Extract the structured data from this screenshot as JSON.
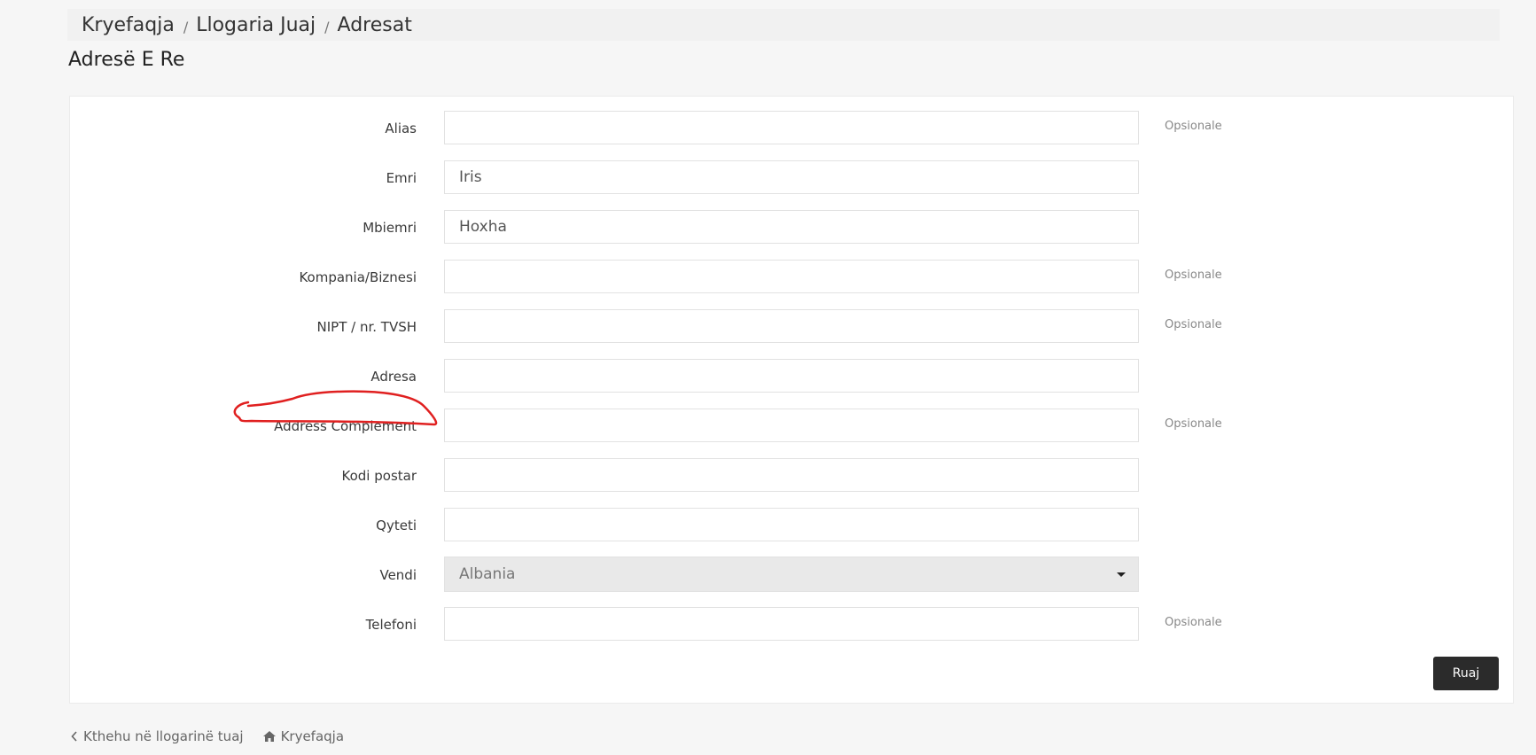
{
  "breadcrumb": {
    "items": [
      "Kryefaqja",
      "Llogaria Juaj",
      "Adresat"
    ],
    "separator": "/"
  },
  "page_title": "Adresë E Re",
  "form": {
    "optional_label": "Opsionale",
    "fields": [
      {
        "label": "Alias",
        "value": "",
        "optional": true
      },
      {
        "label": "Emri",
        "value": "Iris",
        "optional": false
      },
      {
        "label": "Mbiemri",
        "value": "Hoxha",
        "optional": false
      },
      {
        "label": "Kompania/Biznesi",
        "value": "",
        "optional": true
      },
      {
        "label": "NIPT / nr. TVSH",
        "value": "",
        "optional": true
      },
      {
        "label": "Adresa",
        "value": "",
        "optional": false
      },
      {
        "label": "Address Complement",
        "value": "",
        "optional": true
      },
      {
        "label": "Kodi postar",
        "value": "",
        "optional": false
      },
      {
        "label": "Qyteti",
        "value": "",
        "optional": false
      },
      {
        "label": "Vendi",
        "value": "Albania",
        "optional": false,
        "type": "select"
      },
      {
        "label": "Telefoni",
        "value": "",
        "optional": true
      }
    ],
    "save_label": "Ruaj"
  },
  "annotation": {
    "color": "#e02020",
    "target": "Address Complement"
  },
  "footer": {
    "back_label": "Kthehu në llogarinë tuaj",
    "home_label": "Kryefaqja",
    "back_icon": "chevron-left-icon",
    "home_icon": "home-icon"
  }
}
